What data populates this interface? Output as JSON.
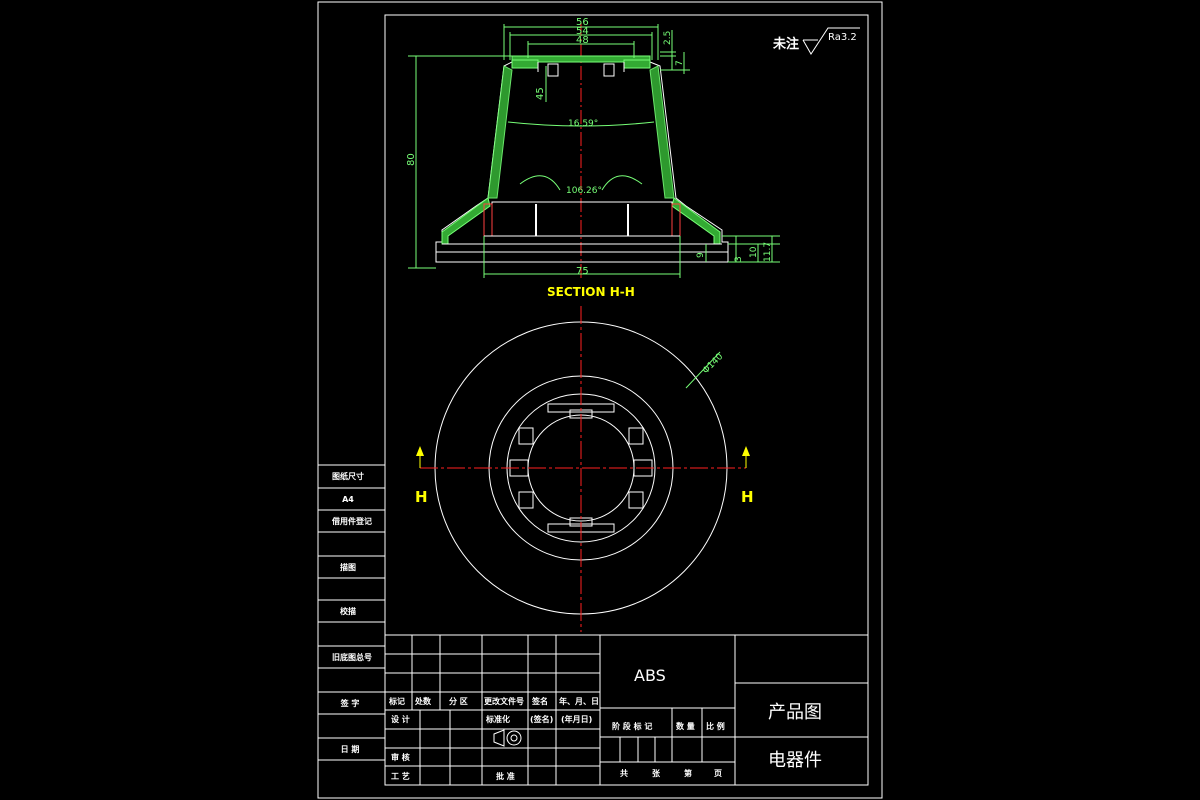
{
  "roughness": {
    "label": "未注",
    "value": "Ra3.2"
  },
  "section_title": "SECTION H-H",
  "cut_marker": "H",
  "dimensions": {
    "d56": "56",
    "d54": "54",
    "d48": "48",
    "d2_5": "2.5",
    "d7": "7",
    "d45": "45",
    "d80": "80",
    "angle_upper": "16.59°",
    "angle_lower": "106.26°",
    "d75": "75",
    "d9": "9",
    "d10": "10",
    "d3": "3",
    "d11_7": "11.7",
    "diam": "Φ140"
  },
  "side_labels": {
    "paper_size": "图纸尺寸",
    "paper_value": "A4",
    "borrow_reg": "借用件登记",
    "trace": "描图",
    "check_trace": "校描",
    "old_base": "旧底图总号",
    "signature": "签 字",
    "date": "日 期"
  },
  "title_block": {
    "revision_header": {
      "mark": "标记",
      "count": "处数",
      "zone": "分 区",
      "doc_no": "更改文件号",
      "sign": "签名",
      "date": "年、月、日"
    },
    "design": "设 计",
    "standardize": "标准化",
    "sign_name": "(签名)",
    "ymd": "(年月日)",
    "review": "审 核",
    "process": "工 艺",
    "approve": "批 准",
    "material": "ABS",
    "stage_header": {
      "stage": "阶 段 标 记",
      "qty": "数 量",
      "scale": "比 例"
    },
    "sheets": {
      "total": "共",
      "sheet": "张",
      "no": "第",
      "page": "页"
    },
    "drawing_name": "产品图",
    "part_name": "电器件"
  }
}
